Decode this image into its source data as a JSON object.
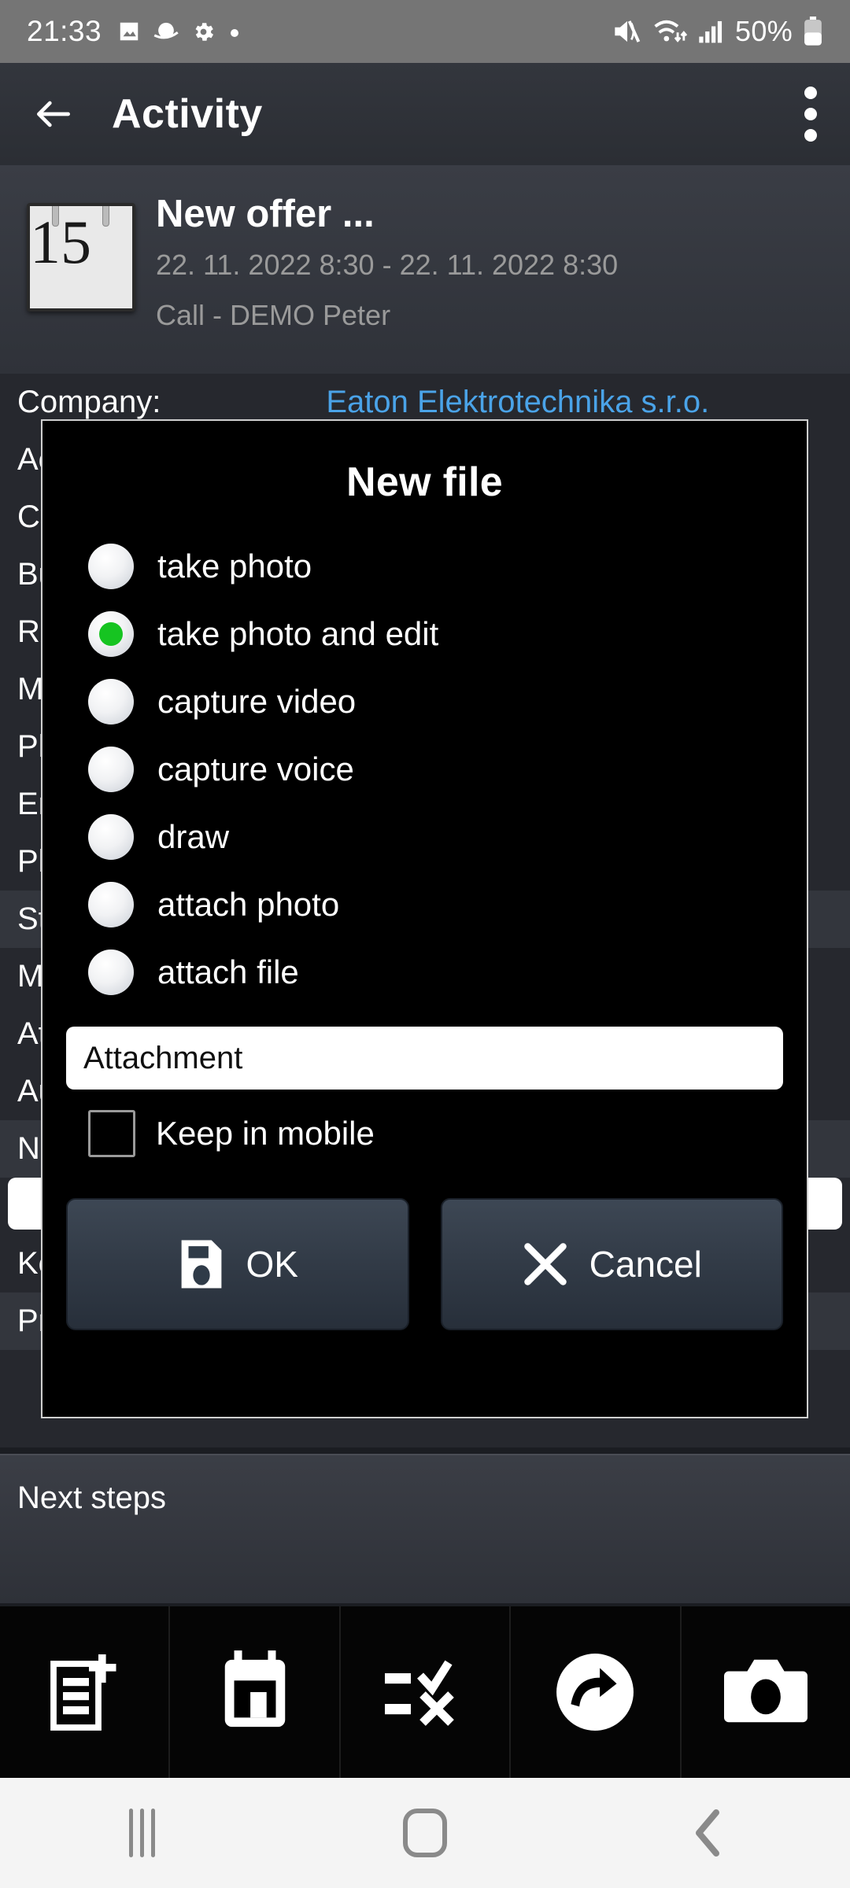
{
  "statusbar": {
    "time": "21:33",
    "battery_pct": "50%",
    "left_icons": [
      "image-icon",
      "planet-icon",
      "gear-icon",
      "dot-icon"
    ],
    "right_icons": [
      "mute-icon",
      "wifi-icon",
      "signal-icon",
      "battery-icon"
    ]
  },
  "appbar": {
    "back": "back-arrow-icon",
    "title": "Activity",
    "overflow": "overflow-menu-icon"
  },
  "event": {
    "calendar_day": "15",
    "title": "New offer ...",
    "dates": "22. 11. 2022 8:30 - 22. 11. 2022 8:30",
    "subtitle": "Call - DEMO Peter"
  },
  "form_rows": [
    {
      "label": "Company:",
      "value": "Eaton Elektrotechnika s.r.o.",
      "link": true,
      "alt": false
    },
    {
      "label": "Ac",
      "value": "",
      "link": false,
      "alt": false
    },
    {
      "label": "Co",
      "value": "",
      "link": false,
      "alt": false
    },
    {
      "label": "Bu",
      "value": "",
      "link": false,
      "alt": false
    },
    {
      "label": "Re",
      "value": "",
      "link": false,
      "alt": false
    },
    {
      "label": "M",
      "value": "",
      "link": false,
      "alt": false
    },
    {
      "label": "Ph",
      "value": "",
      "link": false,
      "alt": false
    },
    {
      "label": "En",
      "value": "",
      "link": false,
      "alt": false
    },
    {
      "label": "Pl",
      "value": "",
      "link": false,
      "alt": false
    },
    {
      "label": "St",
      "value": "",
      "link": false,
      "alt": true
    },
    {
      "label": "M",
      "value": "",
      "link": false,
      "alt": false
    },
    {
      "label": "At",
      "value": "",
      "link": false,
      "alt": false
    },
    {
      "label": "Au",
      "value": "",
      "link": false,
      "alt": false
    },
    {
      "label": "No",
      "value": "",
      "link": false,
      "alt": true
    },
    {
      "label": "",
      "value": "",
      "link": false,
      "alt": false
    },
    {
      "label": "Ke",
      "value": "",
      "link": false,
      "alt": false
    },
    {
      "label": "Pr",
      "value": "",
      "link": false,
      "alt": true
    }
  ],
  "next_steps": {
    "label": "Next steps"
  },
  "toolbar": {
    "buttons": [
      {
        "name": "add-note-icon",
        "label": "new note"
      },
      {
        "name": "calendar-icon",
        "label": "calendar"
      },
      {
        "name": "task-list-icon",
        "label": "tasks"
      },
      {
        "name": "forward-circle-icon",
        "label": "forward"
      },
      {
        "name": "camera-icon",
        "label": "camera"
      }
    ]
  },
  "navbar": {
    "recents": "recents-icon",
    "home": "home-icon",
    "back": "back-icon"
  },
  "dialog": {
    "title": "New file",
    "options": [
      {
        "label": "take photo",
        "selected": false
      },
      {
        "label": "take photo and edit",
        "selected": true
      },
      {
        "label": "capture video",
        "selected": false
      },
      {
        "label": "capture voice",
        "selected": false
      },
      {
        "label": "draw",
        "selected": false
      },
      {
        "label": "attach photo",
        "selected": false
      },
      {
        "label": "attach file",
        "selected": false
      }
    ],
    "filename_value": "Attachment",
    "filename_placeholder": "Attachment",
    "keep_label": "Keep in mobile",
    "keep_checked": false,
    "ok_label": "OK",
    "cancel_label": "Cancel",
    "accent_selected": "#16c421"
  }
}
